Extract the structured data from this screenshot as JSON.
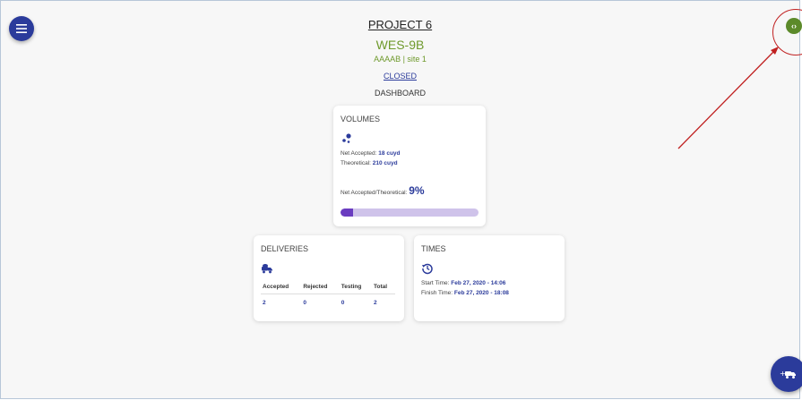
{
  "project": {
    "title": "PROJECT 6",
    "site_code": "WES-9B",
    "site_sub": "AAAAB | site 1",
    "status": "CLOSED",
    "view_label": "DASHBOARD"
  },
  "toggle": {
    "glyph": "‹›"
  },
  "volumes": {
    "title": "VOLUMES",
    "icon": "pour-dots-icon",
    "net_accepted_label": "Net Accepted:",
    "net_accepted_value": "18 cuyd",
    "theoretical_label": "Theoretical:",
    "theoretical_value": "210 cuyd",
    "ratio_label": "Net Accepted/Theoretical:",
    "ratio_value": "9%",
    "progress_fraction": 0.09
  },
  "deliveries": {
    "title": "DELIVERIES",
    "icon": "truck-icon",
    "columns": [
      "Accepted",
      "Rejected",
      "Testing",
      "Total"
    ],
    "values": [
      "2",
      "0",
      "0",
      "2"
    ]
  },
  "times": {
    "title": "TIMES",
    "icon": "history-icon",
    "start_label": "Start Time:",
    "start_value": "Feb 27, 2020 - 14:06",
    "finish_label": "Finish Time:",
    "finish_value": "Feb 27, 2020 - 18:08"
  },
  "colors": {
    "primary": "#2b3b9b",
    "accent_green": "#6f9a2d",
    "progress_fill": "#6a3cc0",
    "progress_track": "#cfc3ea",
    "annotation_red": "#c02020"
  }
}
